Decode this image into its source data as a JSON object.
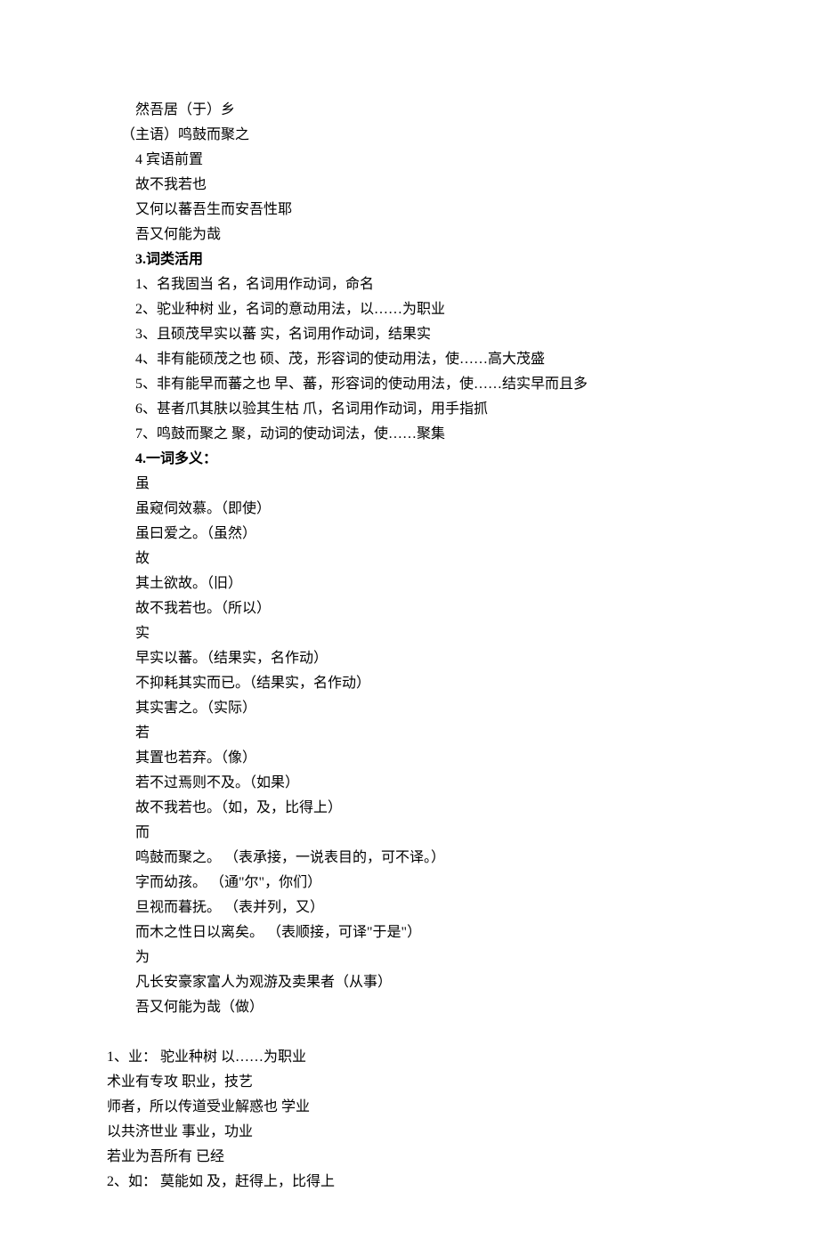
{
  "lines": [
    {
      "text": "然吾居（于）乡",
      "indent": 2,
      "bold": false
    },
    {
      "text": "（主语）鸣鼓而聚之",
      "indent": 1,
      "bold": false
    },
    {
      "text": "4 宾语前置",
      "indent": 2,
      "bold": false
    },
    {
      "text": "故不我若也",
      "indent": 2,
      "bold": false
    },
    {
      "text": "又何以蕃吾生而安吾性耶",
      "indent": 2,
      "bold": false
    },
    {
      "text": "吾又何能为哉",
      "indent": 2,
      "bold": false
    },
    {
      "text": "3.词类活用",
      "indent": 2,
      "bold": true
    },
    {
      "text": "1、名我固当 名，名词用作动词，命名",
      "indent": 2,
      "bold": false
    },
    {
      "text": "2、驼业种树 业，名词的意动用法，以……为职业",
      "indent": 2,
      "bold": false
    },
    {
      "text": "3、且硕茂早实以蕃 实，名词用作动词，结果实",
      "indent": 2,
      "bold": false
    },
    {
      "text": "4、非有能硕茂之也 硕、茂，形容词的使动用法，使……高大茂盛",
      "indent": 2,
      "bold": false
    },
    {
      "text": "5、非有能早而蕃之也 早、蕃，形容词的使动用法，使……结实早而且多",
      "indent": 2,
      "bold": false
    },
    {
      "text": "6、甚者爪其肤以验其生枯 爪，名词用作动词，用手指抓",
      "indent": 2,
      "bold": false
    },
    {
      "text": "7、鸣鼓而聚之 聚，动词的使动词法，使……聚集",
      "indent": 2,
      "bold": false
    },
    {
      "text": "4.一词多义：",
      "indent": 2,
      "bold": true
    },
    {
      "text": "虽",
      "indent": 2,
      "bold": false
    },
    {
      "text": "虽窥伺效慕。（即使）",
      "indent": 2,
      "bold": false
    },
    {
      "text": "虽曰爱之。（虽然）",
      "indent": 2,
      "bold": false
    },
    {
      "text": "故",
      "indent": 2,
      "bold": false
    },
    {
      "text": "其土欲故。（旧）",
      "indent": 2,
      "bold": false
    },
    {
      "text": "故不我若也。（所以）",
      "indent": 2,
      "bold": false
    },
    {
      "text": "实",
      "indent": 2,
      "bold": false
    },
    {
      "text": "早实以蕃。（结果实，名作动）",
      "indent": 2,
      "bold": false
    },
    {
      "text": "不抑耗其实而已。（结果实，名作动）",
      "indent": 2,
      "bold": false
    },
    {
      "text": "其实害之。（实际）",
      "indent": 2,
      "bold": false
    },
    {
      "text": "若",
      "indent": 2,
      "bold": false
    },
    {
      "text": "其置也若弃。（像）",
      "indent": 2,
      "bold": false
    },
    {
      "text": "若不过焉则不及。（如果）",
      "indent": 2,
      "bold": false
    },
    {
      "text": "故不我若也。（如，及，比得上）",
      "indent": 2,
      "bold": false
    },
    {
      "text": "而",
      "indent": 2,
      "bold": false
    },
    {
      "text": "鸣鼓而聚之。 （表承接，一说表目的，可不译。）",
      "indent": 2,
      "bold": false
    },
    {
      "text": "字而幼孩。 （通\"尔\"，你们）",
      "indent": 2,
      "bold": false
    },
    {
      "text": "旦视而暮抚。 （表并列，又）",
      "indent": 2,
      "bold": false
    },
    {
      "text": "而木之性日以离矣。 （表顺接，可译\"于是\"）",
      "indent": 2,
      "bold": false
    },
    {
      "text": "为",
      "indent": 2,
      "bold": false
    },
    {
      "text": "凡长安豪家富人为观游及卖果者（从事）",
      "indent": 2,
      "bold": false
    },
    {
      "text": "吾又何能为哉（做）",
      "indent": 2,
      "bold": false
    },
    {
      "text": "",
      "indent": 0,
      "bold": false,
      "blank": true
    },
    {
      "text": "1、业： 驼业种树 以……为职业",
      "indent": 0,
      "bold": false
    },
    {
      "text": "术业有专攻 职业，技艺",
      "indent": 0,
      "bold": false
    },
    {
      "text": "师者，所以传道受业解惑也 学业",
      "indent": 0,
      "bold": false
    },
    {
      "text": "以共济世业 事业，功业",
      "indent": 0,
      "bold": false
    },
    {
      "text": "若业为吾所有 已经",
      "indent": 0,
      "bold": false
    },
    {
      "text": "2、如： 莫能如 及，赶得上，比得上",
      "indent": 0,
      "bold": false
    }
  ]
}
